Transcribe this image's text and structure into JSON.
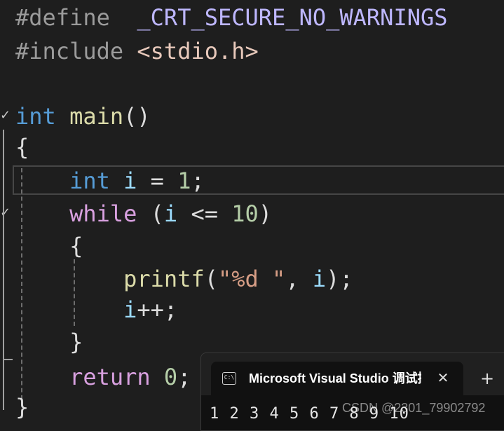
{
  "editor": {
    "lines": {
      "l1": {
        "pre": "#define",
        "macro": "_CRT_SECURE_NO_WARNINGS"
      },
      "l2": {
        "pre": "#include",
        "header": "<stdio.h>"
      },
      "l4": {
        "type": "int",
        "name": "main",
        "parens": "()"
      },
      "l5": {
        "brace": "{"
      },
      "l6": {
        "type": "int",
        "var": "i",
        "op": "=",
        "num": "1",
        "semi": ";"
      },
      "l7": {
        "kw": "while",
        "open": "(",
        "var": "i",
        "op": "<=",
        "num": "10",
        "close": ")"
      },
      "l8": {
        "brace": "{"
      },
      "l9": {
        "fn": "printf",
        "open": "(",
        "str": "\"%d \"",
        "comma": ",",
        "var": "i",
        "close": ");"
      },
      "l10": {
        "var": "i",
        "op": "++;"
      },
      "l11": {
        "brace": "}"
      },
      "l12": {
        "kw": "return",
        "num": "0",
        "semi": ";"
      },
      "l13": {
        "brace": "}"
      }
    },
    "fold_icons": [
      "chevron-down-icon",
      "chevron-down-icon"
    ]
  },
  "terminal": {
    "icon": "console-icon",
    "icon_text": "C:\\",
    "title": "Microsoft Visual Studio 调试控制台",
    "close_glyph": "✕",
    "new_tab_glyph": "+",
    "output": "1 2 3 4 5 6 7 8 9 10"
  },
  "watermark": "CSDN @2301_79902792",
  "colors": {
    "background": "#1e1e1e",
    "keyword": "#569cd6",
    "control": "#d8a0df",
    "function": "#dcdcaa",
    "variable": "#9cdcfe",
    "number": "#b5cea8",
    "string": "#d69d85",
    "macro": "#beb7ff",
    "preprocessor": "#9b9b9b"
  }
}
